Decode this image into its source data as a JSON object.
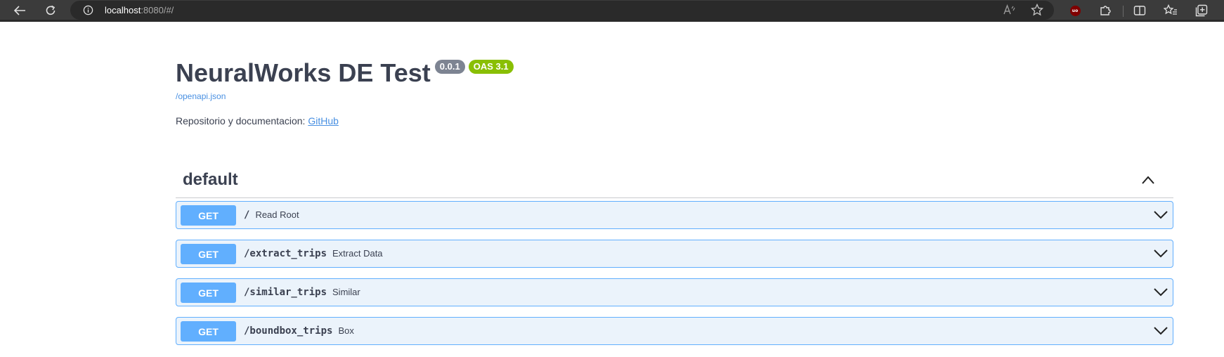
{
  "browser": {
    "url_host": "localhost",
    "url_rest": ":8080/#/",
    "icons": [
      "back-arrow-icon",
      "refresh-icon",
      "info-icon",
      "read-aloud-icon",
      "favorite-star-icon",
      "ublock-origin-icon",
      "extensions-icon",
      "split-screen-icon",
      "favorites-list-icon",
      "collections-icon"
    ],
    "ublock_label": "uo"
  },
  "info": {
    "title": "NeuralWorks DE Test",
    "version": "0.0.1",
    "oas": "OAS 3.1",
    "spec_link": "/openapi.json",
    "description_prefix": "Repositorio y documentacion: ",
    "github_label": "GitHub"
  },
  "tag": {
    "name": "default",
    "expanded": true
  },
  "operations": [
    {
      "method": "GET",
      "path": "/",
      "summary": "Read Root"
    },
    {
      "method": "GET",
      "path": "/extract_trips",
      "summary": "Extract Data"
    },
    {
      "method": "GET",
      "path": "/similar_trips",
      "summary": "Similar"
    },
    {
      "method": "GET",
      "path": "/boundbox_trips",
      "summary": "Box"
    }
  ],
  "colors": {
    "get_method": "#61affe",
    "get_background": "#ebf3fb",
    "version_badge": "#7d8492",
    "oas_badge": "#89bf04",
    "link": "#4990e2",
    "text": "#3b4151"
  }
}
